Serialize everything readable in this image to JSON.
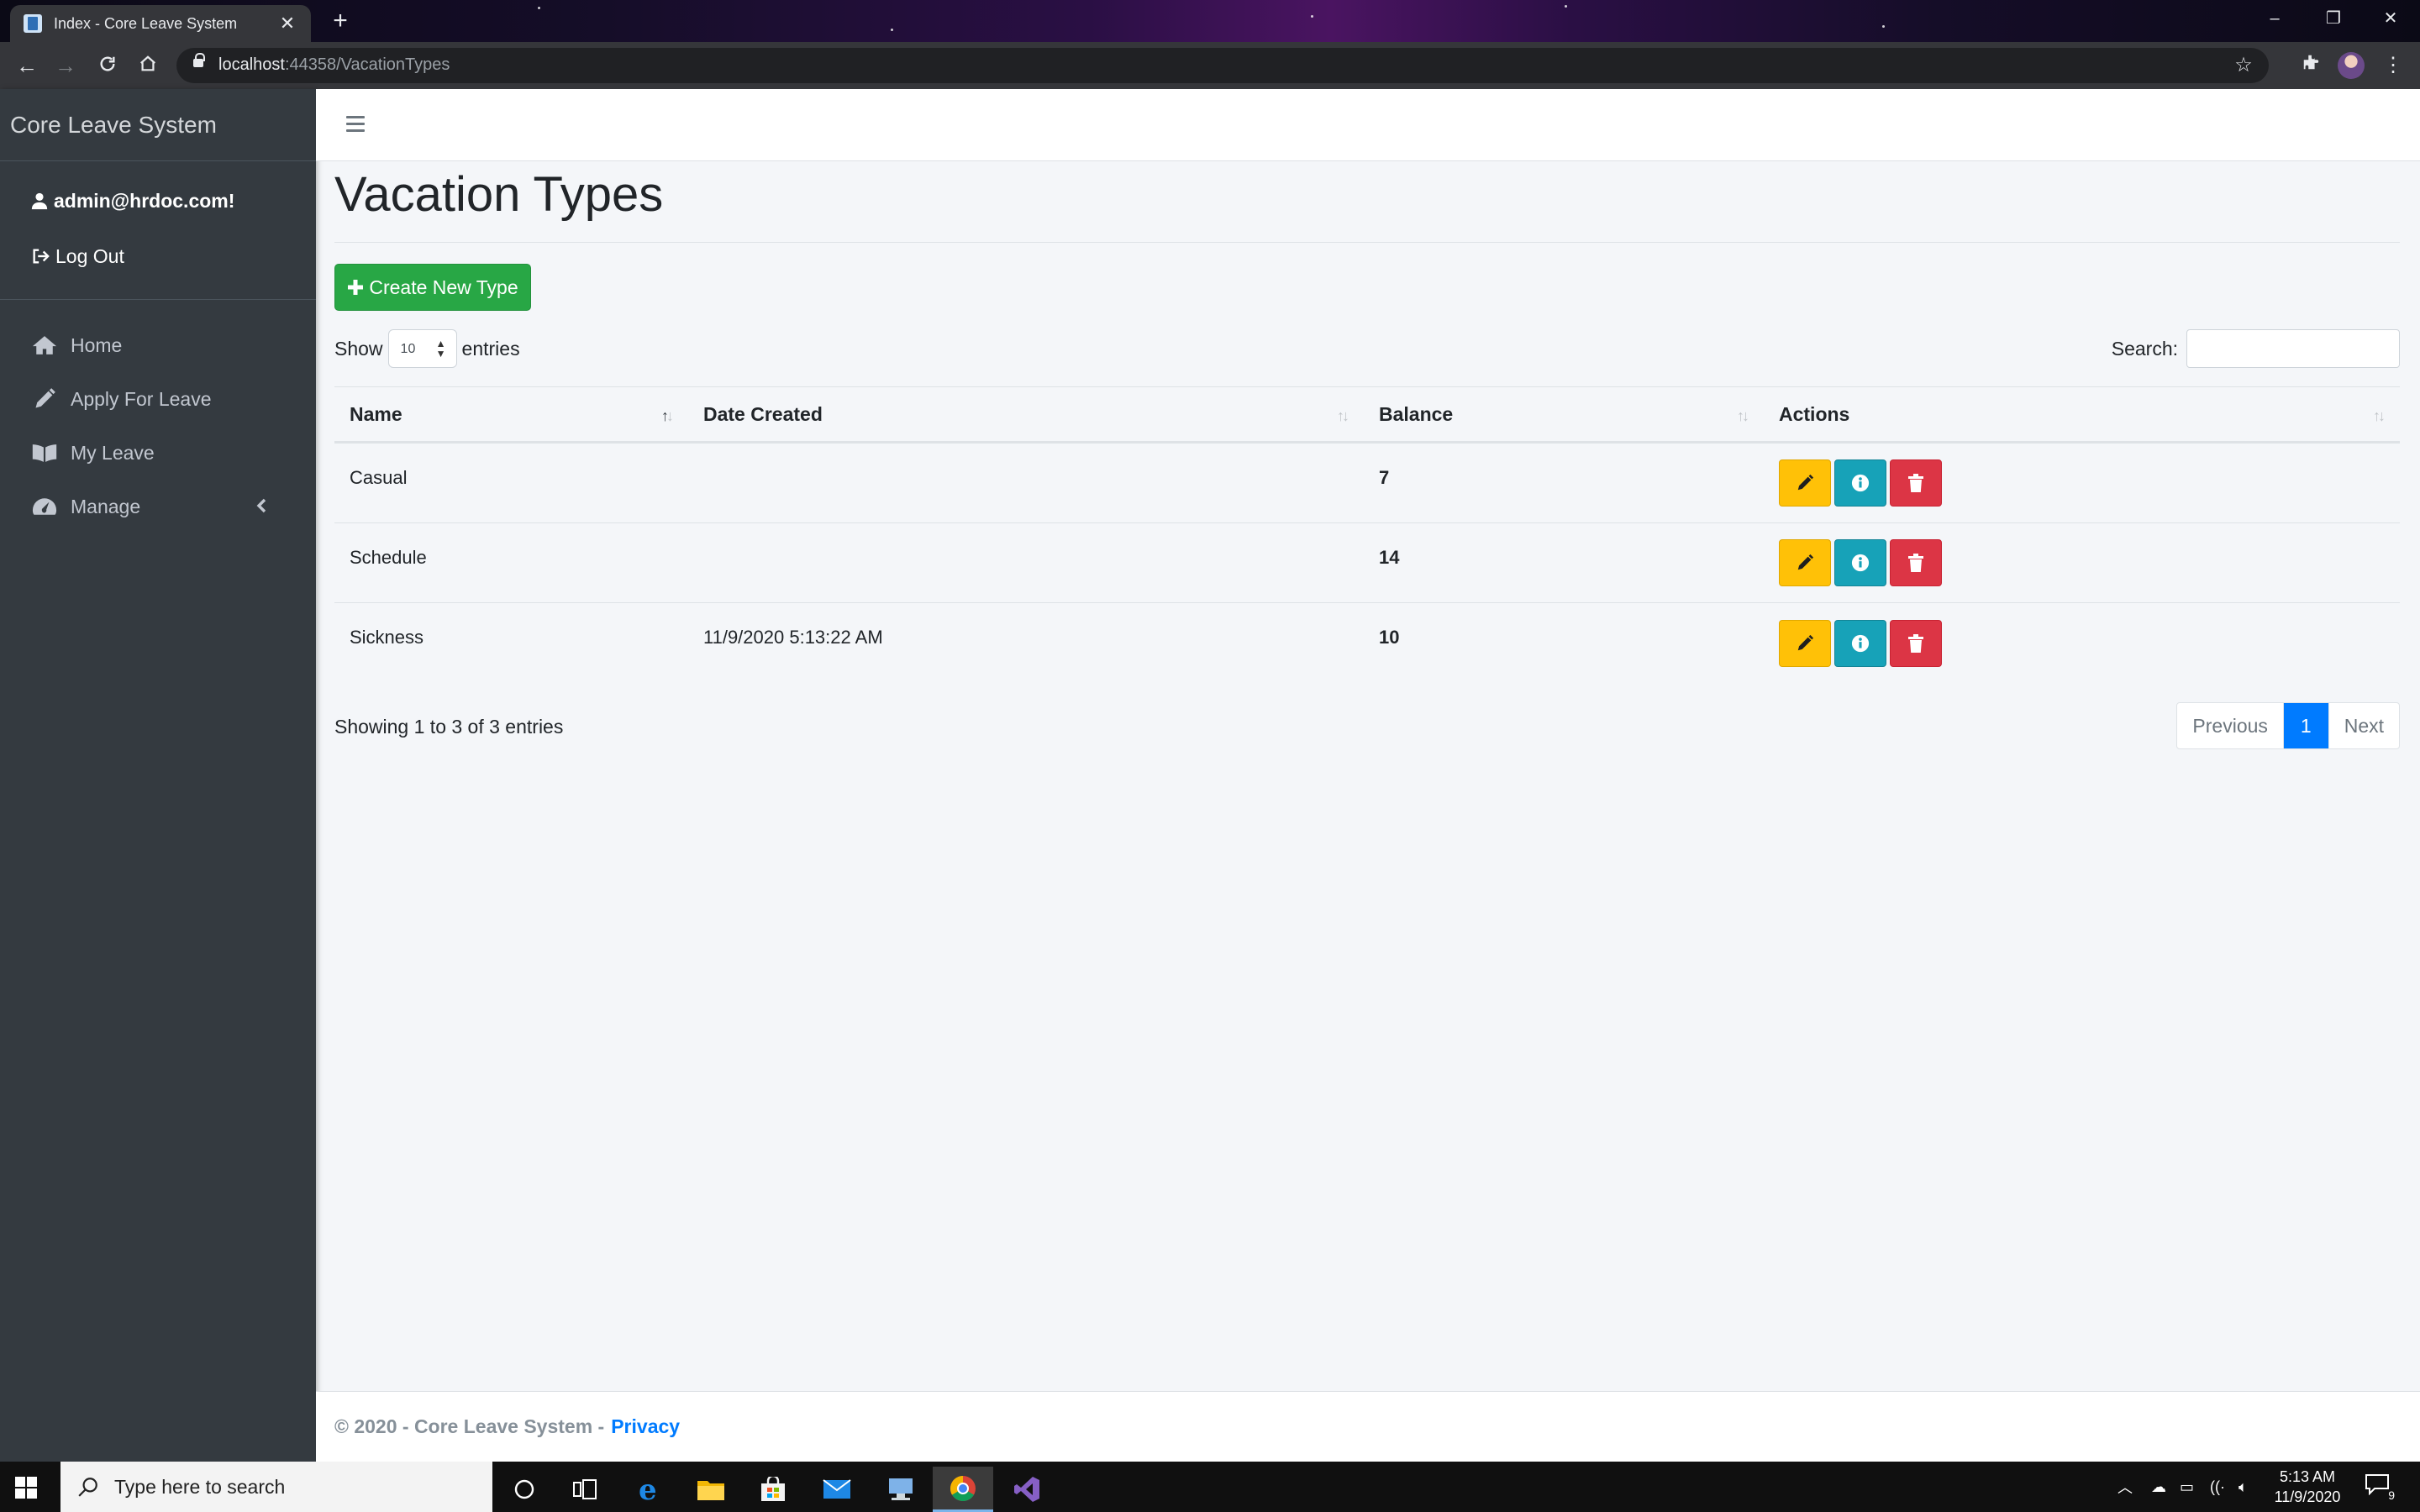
{
  "browser": {
    "tab_title": "Index - Core Leave System",
    "url_host": "localhost",
    "url_rest": ":44358/VacationTypes"
  },
  "sidebar": {
    "brand": "Core Leave System",
    "user_email": "admin@hrdoc.com!",
    "logout_label": "Log Out",
    "items": [
      {
        "label": "Home",
        "icon": "home-icon"
      },
      {
        "label": "Apply For Leave",
        "icon": "pencil-icon"
      },
      {
        "label": "My Leave",
        "icon": "book-icon"
      },
      {
        "label": "Manage",
        "icon": "dashboard-icon"
      }
    ]
  },
  "main": {
    "title": "Vacation Types",
    "create_button": "Create New Type",
    "show_label": "Show",
    "entries_label": "entries",
    "page_length": "10",
    "search_label": "Search:",
    "search_value": "",
    "columns": [
      "Name",
      "Date Created",
      "Balance",
      "Actions"
    ],
    "rows": [
      {
        "name": "Casual",
        "date_created": "",
        "balance": "7"
      },
      {
        "name": "Schedule",
        "date_created": "",
        "balance": "14"
      },
      {
        "name": "Sickness",
        "date_created": "11/9/2020 5:13:22 AM",
        "balance": "10"
      }
    ],
    "info": "Showing 1 to 3 of 3 entries",
    "pagination": {
      "previous": "Previous",
      "current": "1",
      "next": "Next"
    }
  },
  "footer": {
    "copyright": "© 2020 - Core Leave System -",
    "privacy": "Privacy"
  },
  "taskbar": {
    "search_placeholder": "Type here to search",
    "time": "5:13 AM",
    "date": "11/9/2020",
    "notification_count": "9"
  },
  "colors": {
    "sidebar_bg": "#343a40",
    "success": "#28a745",
    "warning": "#ffc107",
    "info": "#17a2b8",
    "danger": "#dc3545",
    "primary": "#007bff"
  }
}
